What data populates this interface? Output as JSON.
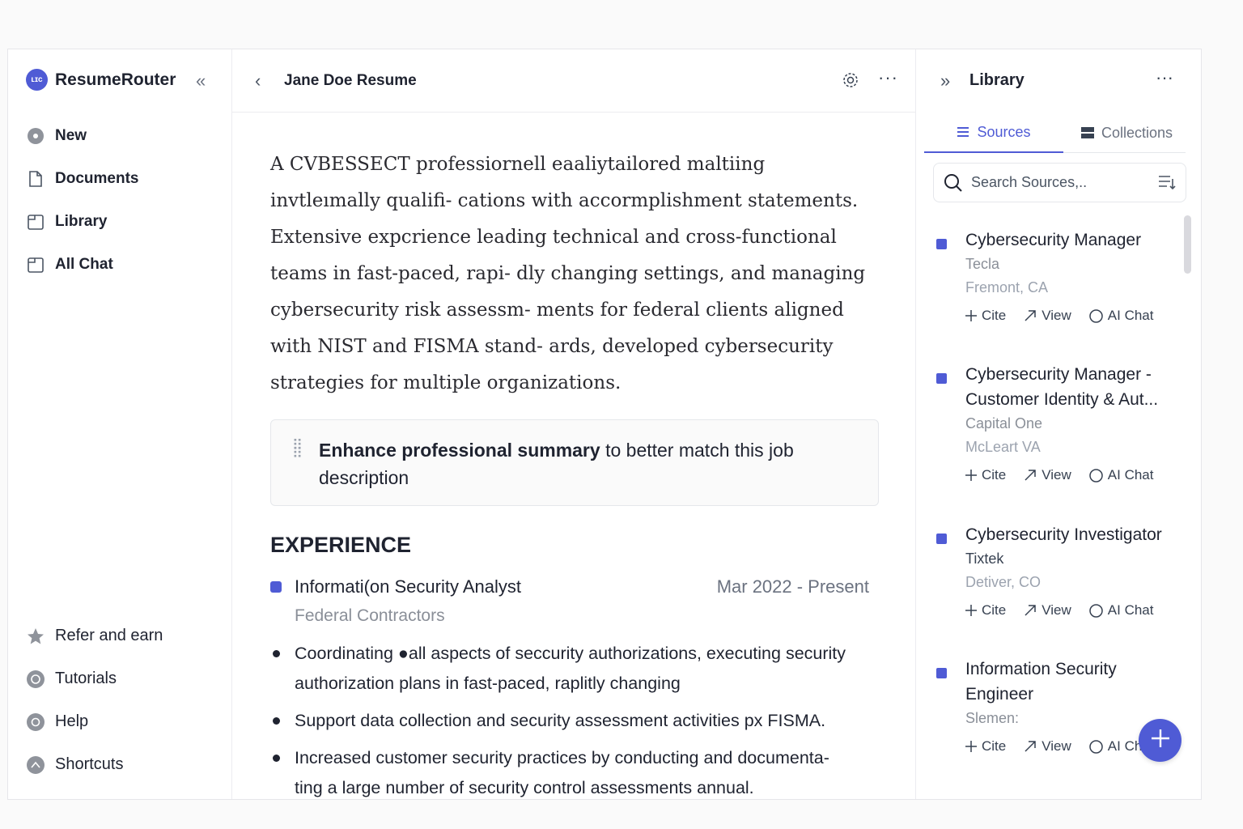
{
  "brand": {
    "name": "ResumeRouter",
    "logo_text": "ʟɪᴄ"
  },
  "sidebar": {
    "items": [
      {
        "label": "New",
        "icon": "plus-circle-icon"
      },
      {
        "label": "Documents",
        "icon": "document-icon"
      },
      {
        "label": "Library",
        "icon": "library-icon"
      },
      {
        "label": "All Chat",
        "icon": "chat-icon"
      }
    ],
    "bottom_items": [
      {
        "label": "Refer and earn",
        "icon": "star-icon"
      },
      {
        "label": "Tutorials",
        "icon": "tutorials-icon"
      },
      {
        "label": "Help",
        "icon": "help-icon"
      },
      {
        "label": "Shortcuts",
        "icon": "shortcuts-icon"
      }
    ]
  },
  "document": {
    "title": "Jane Doe Resume",
    "summary": "A CVBESSECT professiornell eaaliytailored maltiing invtleımally qualifi- cations with accormplishment statements. Extensive expcrience leading technical and cross-functional teams in fast-paced, rapi- dly changing settings, and managing cybersecurity risk assessm- ments for federal clients aligned with NIST and FISMA stand- ards, developed cybersecurity strategies for multiple organizations.",
    "suggestion": {
      "bold": "Enhance professional summary",
      "rest": " to better match this job description"
    },
    "experience_heading": "EXPERIENCE",
    "job": {
      "title": "Informati(on Security Analyst",
      "dates": "Mar 2022 - Present",
      "company": "Federal Contractors",
      "bullets": [
        "Coordinating ●all aspects of seccurity authorizations, executing security authorization plans in fast-paced, raplitly changing",
        "Support data collection and security assessment activities px FISMA.",
        "Increased customer security practices by conducting and documenta- ting a large number of security control assessments annual."
      ]
    }
  },
  "library": {
    "title": "Library",
    "tabs": [
      {
        "label": "Sources",
        "active": true
      },
      {
        "label": "Collections",
        "active": false
      }
    ],
    "search_placeholder": "Search Sources,..",
    "actions": {
      "cite": "Cite",
      "view": "View",
      "chat": "AI Chat",
      "chat_truncated": "AI Ch"
    },
    "sources": [
      {
        "title": "Cybersecurity Manager",
        "company": "Tecla",
        "location": "Fremont, CA"
      },
      {
        "title": "Cybersecurity Manager - Customer Identity & Aut...",
        "company": "Capital One",
        "location": "McLeart VA"
      },
      {
        "title": "Cybersecurity Investigator",
        "company": "Tixtek",
        "location": "Detiver, CO"
      },
      {
        "title": "Information Security Engineer",
        "company": "Slemen:",
        "location": ""
      }
    ]
  },
  "colors": {
    "accent": "#4f5bd5",
    "text": "#1f2330",
    "muted": "#8a8f98"
  }
}
